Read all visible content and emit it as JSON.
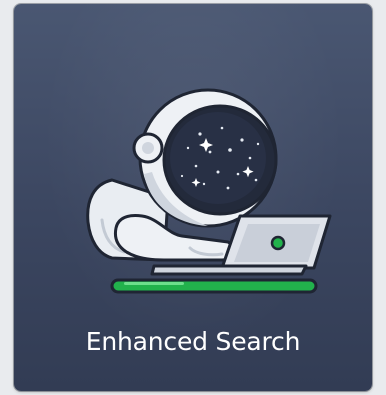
{
  "card": {
    "title": "Enhanced Search",
    "illustration_icon": "astronaut-with-laptop-icon"
  },
  "colors": {
    "card_bg_top": "#4a5772",
    "card_bg_bottom": "#323c54",
    "label_text": "#ffffff",
    "accent_green": "#22b24c",
    "helmet_visor": "#232a3b"
  }
}
